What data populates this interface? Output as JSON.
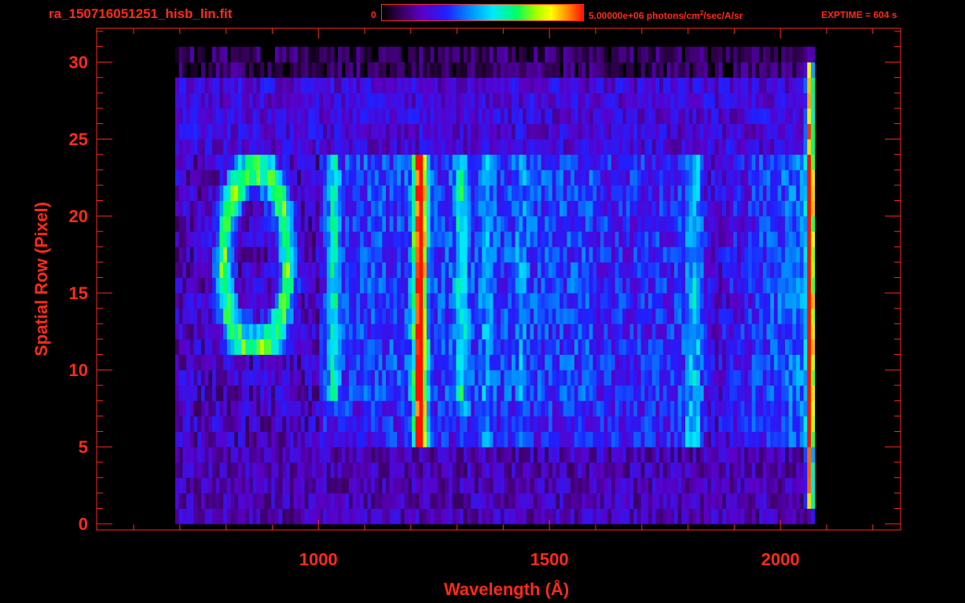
{
  "header": {
    "filename": "ra_150716051251_hisb_lin.fit",
    "colorbar_min": "0",
    "colorbar_max_prefix": "5.00000e+06 photons/cm",
    "colorbar_max_exp": "2",
    "colorbar_max_suffix": "/sec/A/sr",
    "exptime": "EXPTIME = 604 s"
  },
  "colors": {
    "axis": "#ff2a1a",
    "background": "#000000"
  },
  "chart_data": {
    "type": "heatmap",
    "title": "ra_150716051251_hisb_lin.fit",
    "xlabel": "Wavelength (Å)",
    "ylabel": "Spatial Row (Pixel)",
    "xlim": [
      520,
      2260
    ],
    "ylim": [
      0,
      30
    ],
    "xticks": [
      1000,
      1500,
      2000
    ],
    "yticks": [
      0,
      5,
      10,
      15,
      20,
      25,
      30
    ],
    "colorscale": {
      "min": 0,
      "max": 5000000,
      "units": "photons/cm^2/sec/A/sr",
      "colormap": "rainbow"
    },
    "grid": false,
    "features": [
      {
        "wavelength": 1216,
        "rows": [
          5,
          24
        ],
        "peak_intensity": "high"
      },
      {
        "wavelength": 1030,
        "rows": [
          8,
          24
        ],
        "peak_intensity": "medium"
      },
      {
        "wavelength": 1300,
        "rows": [
          7,
          24
        ],
        "peak_intensity": "medium"
      },
      {
        "wavelength": 1810,
        "rows": [
          6,
          24
        ],
        "peak_intensity": "medium"
      },
      {
        "wavelength": 2060,
        "rows": [
          1,
          30
        ],
        "peak_intensity": "high"
      }
    ]
  }
}
